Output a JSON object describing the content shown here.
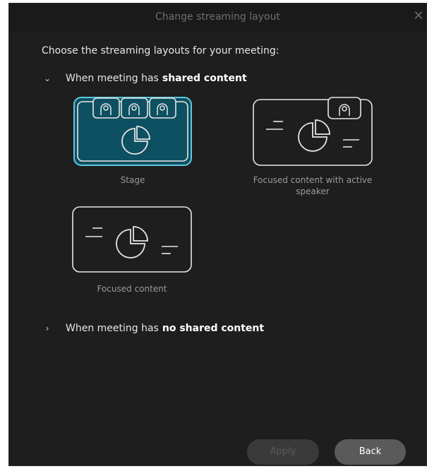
{
  "dialog": {
    "title": "Change streaming layout",
    "close_label": "✕"
  },
  "heading": "Choose the streaming layouts for your meeting:",
  "sections": [
    {
      "chevron": "⌄",
      "prefix": "When meeting has",
      "bold": "shared content",
      "expanded": true
    },
    {
      "chevron": "›",
      "prefix": "When meeting has",
      "bold": "no shared content",
      "expanded": false
    }
  ],
  "layouts": [
    {
      "label": "Stage",
      "selected": true
    },
    {
      "label": "Focused content with active speaker",
      "selected": false
    },
    {
      "label": "Focused content",
      "selected": false
    }
  ],
  "buttons": {
    "apply": "Apply",
    "back": "Back"
  },
  "colors": {
    "selected_fill": "#0d5061",
    "accent_border": "#5ec8e0",
    "background": "#1e1e1e"
  }
}
